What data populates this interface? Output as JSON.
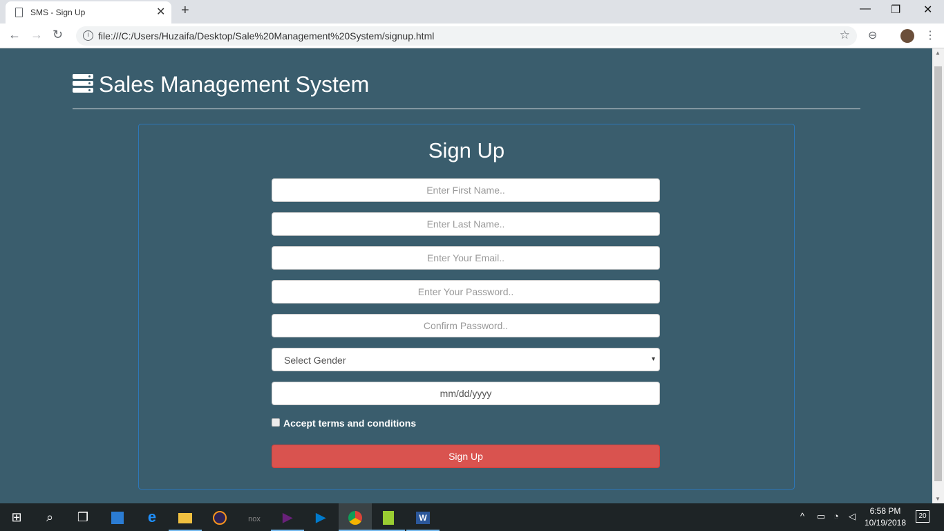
{
  "browser": {
    "tab_title": "SMS - Sign Up",
    "tab_close": "✕",
    "new_tab": "+",
    "minimize": "—",
    "restore": "❐",
    "close": "✕",
    "back": "←",
    "forward": "→",
    "reload": "↻",
    "info": "i",
    "url": "file:///C:/Users/Huzaifa/Desktop/Sale%20Management%20System/signup.html",
    "star": "☆",
    "zoom": "⊖",
    "menu": "⋮"
  },
  "page": {
    "brand": "Sales Management System",
    "form_title": "Sign Up",
    "first_name_placeholder": "Enter First Name..",
    "last_name_placeholder": "Enter Last Name..",
    "email_placeholder": "Enter Your Email..",
    "password_placeholder": "Enter Your Password..",
    "confirm_placeholder": "Confirm Password..",
    "gender_value": "Select Gender",
    "gender_arrow": "▾",
    "date_value": "mm/dd/yyyy",
    "terms_label": "Accept terms and conditions",
    "terms_checked": false,
    "submit_label": "Sign Up"
  },
  "taskbar": {
    "start": "⊞",
    "search": "⌕",
    "task_view": "❐",
    "apps": [
      "store",
      "edge",
      "file-explorer",
      "eclipse",
      "nox",
      "visual-studio",
      "vs-code",
      "chrome",
      "notepad-plus",
      "word"
    ],
    "active_app": "chrome",
    "tray_chevron": "^",
    "time": "6:58 PM",
    "date": "10/19/2018",
    "notifications": "20"
  },
  "colors": {
    "page_bg": "#3a5d6d",
    "card_border": "#2d77b8",
    "submit_bg": "#d9534f"
  }
}
